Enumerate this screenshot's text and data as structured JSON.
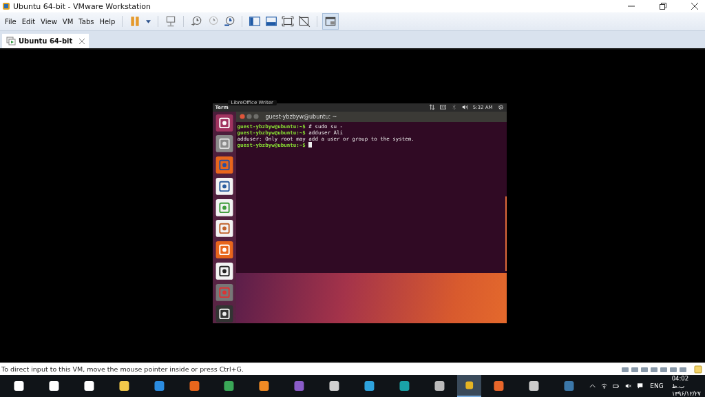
{
  "window": {
    "title": "Ubuntu 64-bit - VMware Workstation"
  },
  "menu": [
    "File",
    "Edit",
    "View",
    "VM",
    "Tabs",
    "Help"
  ],
  "tabs": [
    {
      "label": "Ubuntu 64-bit",
      "selected": true
    }
  ],
  "vm": {
    "panel": {
      "app": "Term",
      "tooltip": "LibreOffice Writer",
      "time": "5:32 AM"
    },
    "terminal": {
      "title": "guest-ybzbyw@ubuntu: ~",
      "lines": [
        {
          "kind": "prompt",
          "prompt": "guest-ybzbyw@ubuntu:~$",
          "text": "# sudo su -",
          "cursor": false
        },
        {
          "kind": "prompt",
          "prompt": "guest-ybzbyw@ubuntu:~$",
          "text": "adduser Ali",
          "cursor": false
        },
        {
          "kind": "output",
          "text": "adduser: Only root may add a user or group to the system."
        },
        {
          "kind": "prompt",
          "prompt": "guest-ybzbyw@ubuntu:~$",
          "cursor": true
        }
      ]
    }
  },
  "status_bar": {
    "text": "To direct input to this VM, move the mouse pointer inside or press Ctrl+G."
  },
  "taskbar": {
    "language": "ENG",
    "time": "04:02 ب.ظ",
    "date": "۱۳۹۶/۱۲/۲۷"
  }
}
